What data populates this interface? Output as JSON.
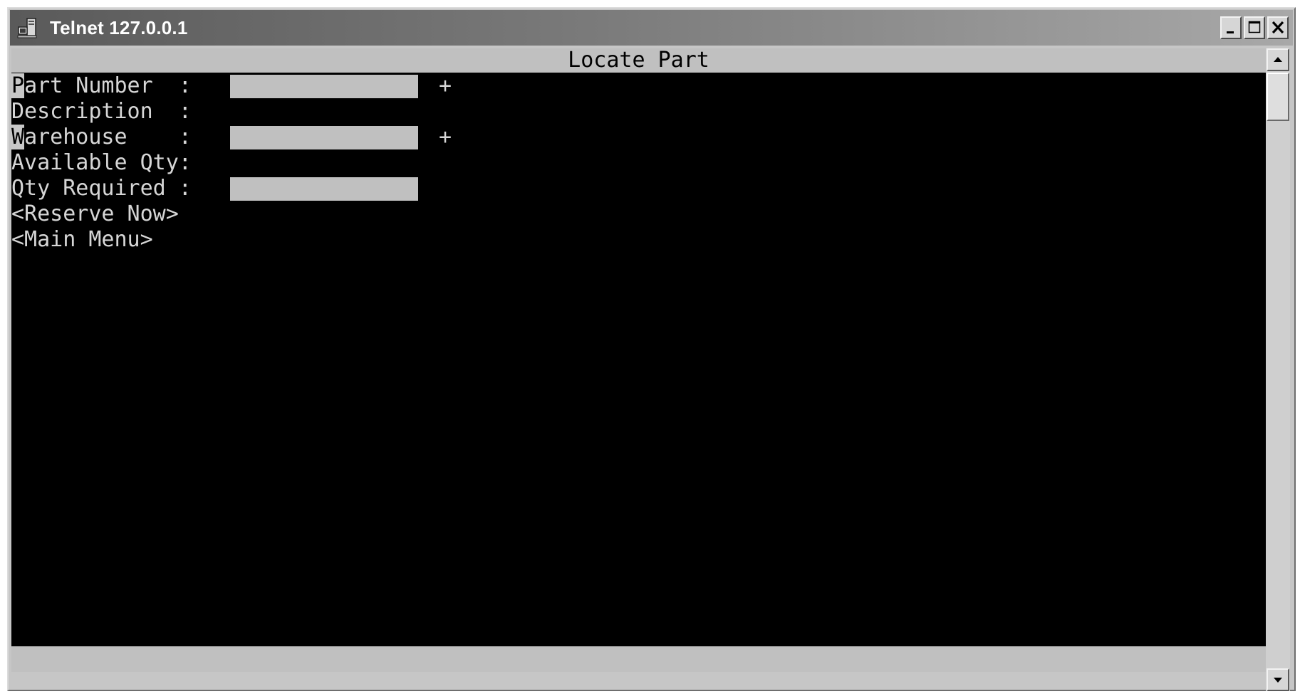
{
  "window": {
    "title": "Telnet 127.0.0.1",
    "icons": {
      "app": "telnet-computer-icon",
      "minimize": "minimize-icon",
      "maximize": "maximize-icon",
      "close": "close-icon"
    }
  },
  "screen": {
    "header": "Locate Part",
    "fields": [
      {
        "cursor_char": "P",
        "label_rest": "art Number  :",
        "value": "",
        "lookup": "+"
      },
      {
        "label": "Description  :"
      },
      {
        "cursor_char": "W",
        "label_rest": "arehouse    :",
        "value": "",
        "lookup": "+"
      },
      {
        "label": "Available Qty:"
      },
      {
        "label": "Qty Required :",
        "value": ""
      }
    ],
    "actions": [
      {
        "label": "<Reserve Now>"
      },
      {
        "label": "<Main Menu>"
      }
    ]
  },
  "scrollbar": {
    "up_icon": "arrow-up-icon",
    "down_icon": "arrow-down-icon"
  },
  "colors": {
    "terminal_bg": "#000000",
    "terminal_text": "#d6d6d6",
    "field_bg": "#c0c0c0",
    "titlebar_start": "#5a5a5a",
    "titlebar_end": "#a8a8a8"
  }
}
